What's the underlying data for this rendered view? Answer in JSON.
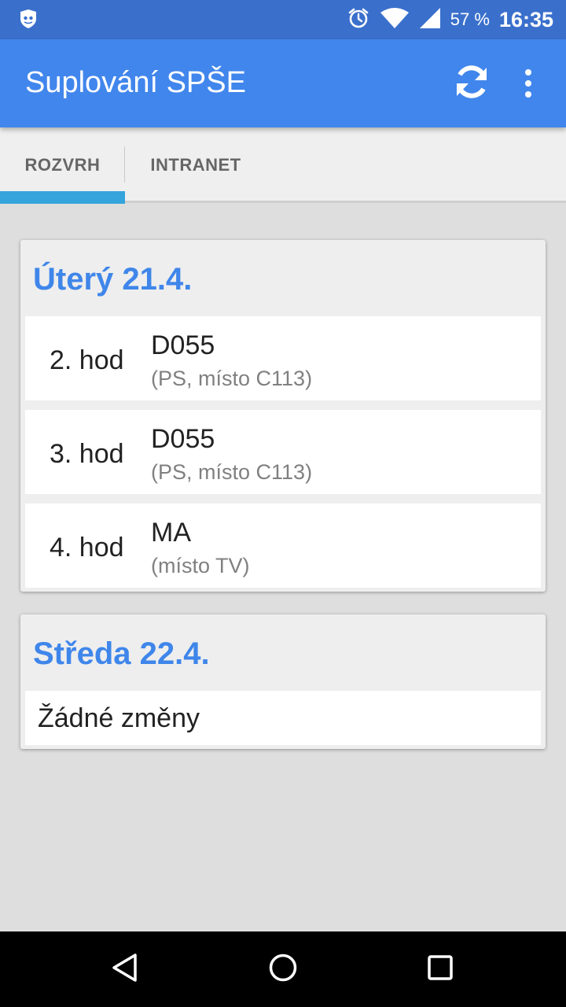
{
  "status_bar": {
    "battery_percent": "57 %",
    "time": "16:35",
    "icons": [
      "app-shield-icon",
      "alarm-icon",
      "wifi-icon",
      "signal-icon"
    ]
  },
  "app_bar": {
    "title": "Suplování SPŠE",
    "actions": [
      "refresh-icon",
      "overflow-menu-icon"
    ]
  },
  "tabs": [
    {
      "label": "ROZVRH",
      "selected": true
    },
    {
      "label": "INTRANET",
      "selected": false
    }
  ],
  "days": [
    {
      "title": "Úterý 21.4.",
      "changes": [
        {
          "hour": "2. hod",
          "subject": "D055",
          "note": "(PS, místo C113)"
        },
        {
          "hour": "3. hod",
          "subject": "D055",
          "note": "(PS, místo C113)"
        },
        {
          "hour": "4. hod",
          "subject": "MA",
          "note": "(místo TV)"
        }
      ]
    },
    {
      "title": "Středa 22.4.",
      "empty_text": "Žádné změny"
    }
  ],
  "nav_bar": {
    "buttons": [
      "back-icon",
      "home-icon",
      "recents-icon"
    ]
  },
  "colors": {
    "status_bar": "#3a70cc",
    "app_bar": "#4186ec",
    "accent_title": "#3f86ea",
    "tab_indicator": "#35a4dc",
    "background": "#dedede"
  }
}
